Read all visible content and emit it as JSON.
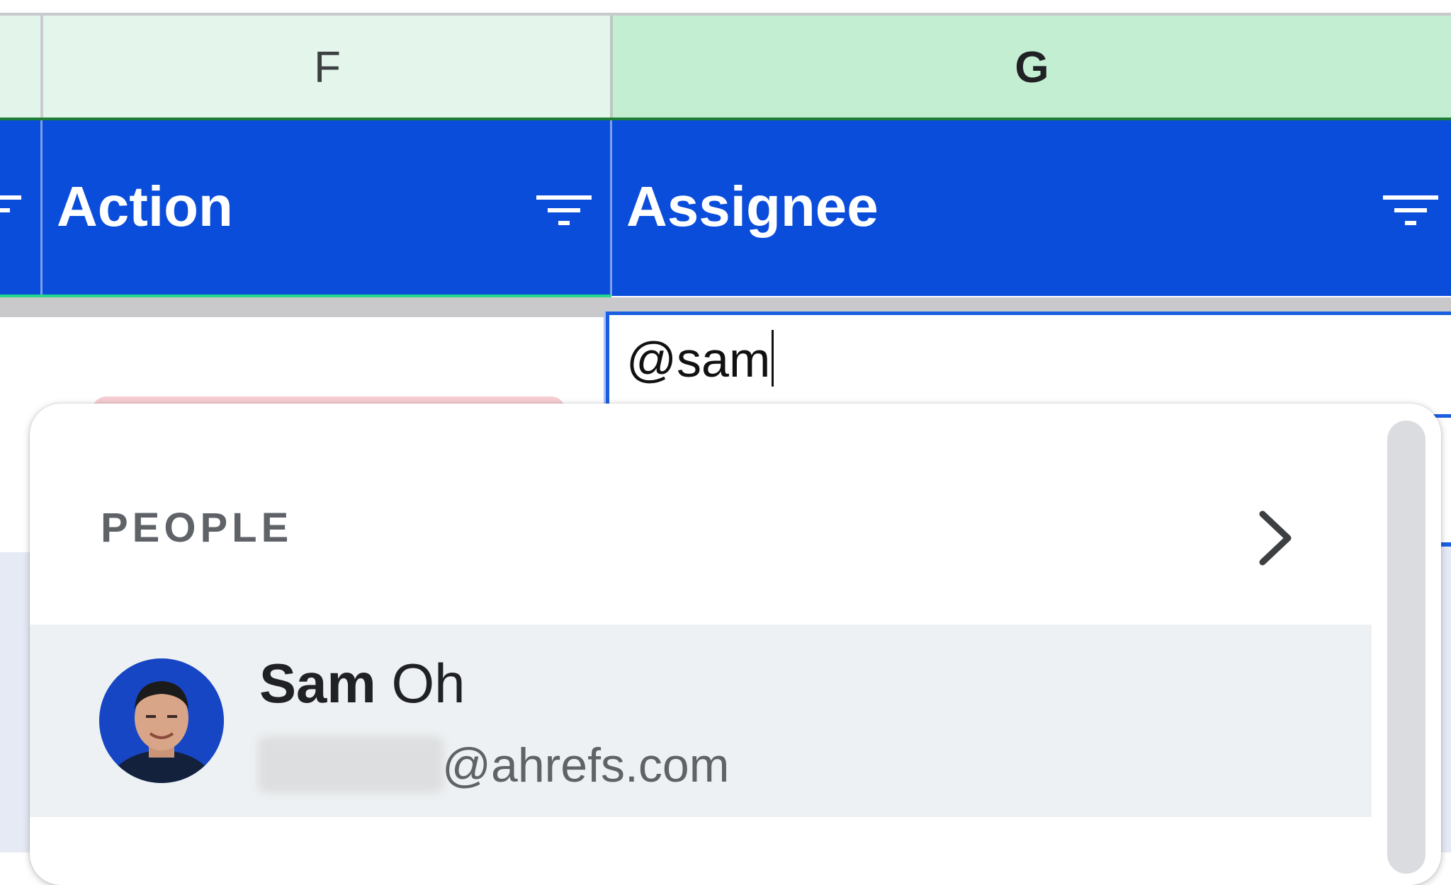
{
  "columns": {
    "f_letter": "F",
    "g_letter": "G"
  },
  "header": {
    "action_label": "Action",
    "assignee_label": "Assignee"
  },
  "editor": {
    "input_value": "@sam"
  },
  "suggestions": {
    "section_label": "PEOPLE",
    "person": {
      "first_name": "Sam",
      "last_name": "Oh",
      "email_domain": "@ahrefs.com"
    }
  },
  "colors": {
    "header_blue": "#0b4ddb",
    "selected_column": "#c4eed2",
    "accent": "#1a5fe0"
  },
  "icons": [
    "filter-icon",
    "chevron-right-icon",
    "avatar"
  ]
}
